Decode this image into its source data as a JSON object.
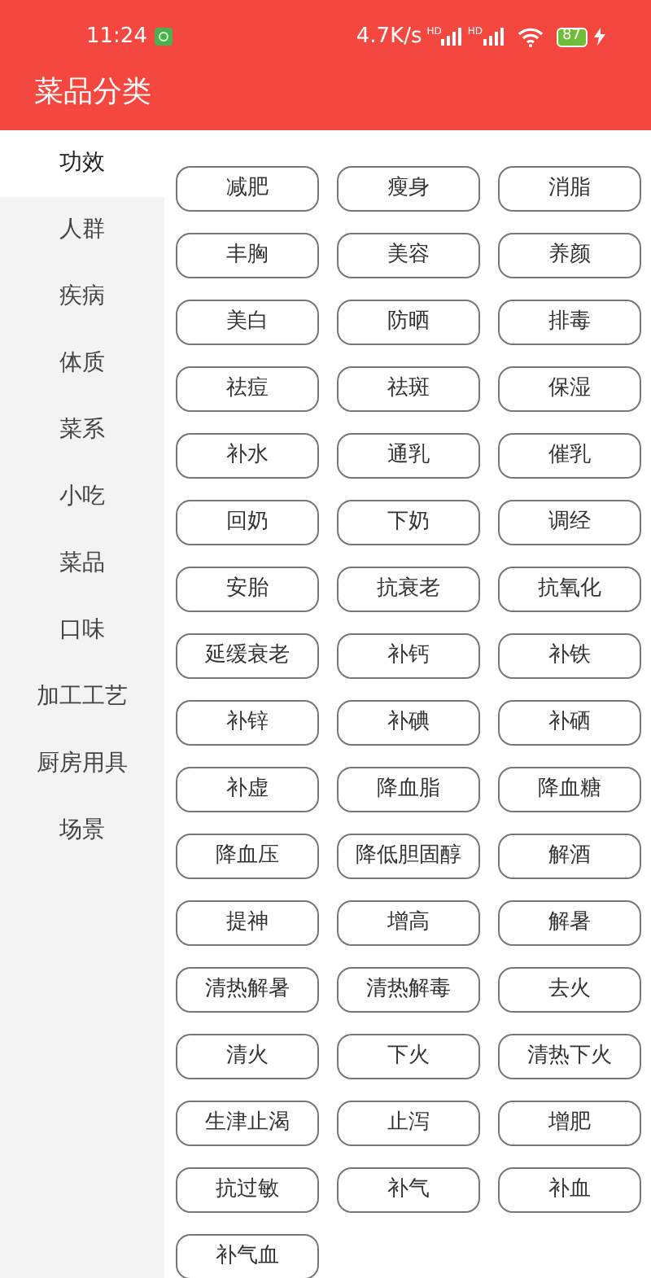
{
  "status_bar": {
    "time": "11:24",
    "network_speed": "4.7K/s",
    "signal_badges": [
      "HD",
      "HD"
    ],
    "battery": "87"
  },
  "header": {
    "title": "菜品分类"
  },
  "sidebar": {
    "items": [
      {
        "label": "功效",
        "selected": true
      },
      {
        "label": "人群",
        "selected": false
      },
      {
        "label": "疾病",
        "selected": false
      },
      {
        "label": "体质",
        "selected": false
      },
      {
        "label": "菜系",
        "selected": false
      },
      {
        "label": "小吃",
        "selected": false
      },
      {
        "label": "菜品",
        "selected": false
      },
      {
        "label": "口味",
        "selected": false
      },
      {
        "label": "加工工艺",
        "selected": false
      },
      {
        "label": "厨房用具",
        "selected": false
      },
      {
        "label": "场景",
        "selected": false
      }
    ]
  },
  "tags": [
    "减肥",
    "瘦身",
    "消脂",
    "丰胸",
    "美容",
    "养颜",
    "美白",
    "防晒",
    "排毒",
    "祛痘",
    "祛斑",
    "保湿",
    "补水",
    "通乳",
    "催乳",
    "回奶",
    "下奶",
    "调经",
    "安胎",
    "抗衰老",
    "抗氧化",
    "延缓衰老",
    "补钙",
    "补铁",
    "补锌",
    "补碘",
    "补硒",
    "补虚",
    "降血脂",
    "降血糖",
    "降血压",
    "降低胆固醇",
    "解酒",
    "提神",
    "增高",
    "解暑",
    "清热解暑",
    "清热解毒",
    "去火",
    "清火",
    "下火",
    "清热下火",
    "生津止渴",
    "止泻",
    "增肥",
    "抗过敏",
    "补气",
    "补血",
    "补气血"
  ]
}
